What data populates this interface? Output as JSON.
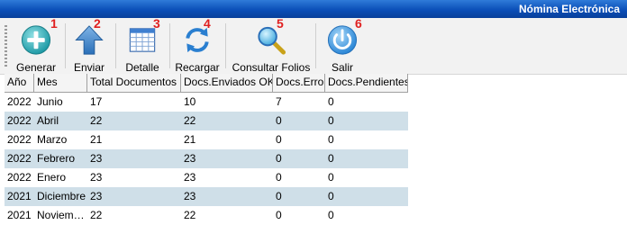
{
  "window": {
    "title": "Nómina Electrónica"
  },
  "toolbar": {
    "buttons": [
      {
        "label": "Generar",
        "badge": "1",
        "icon": "plus-circle-icon"
      },
      {
        "label": "Enviar",
        "badge": "2",
        "icon": "up-arrow-icon"
      },
      {
        "label": "Detalle",
        "badge": "3",
        "icon": "table-grid-icon"
      },
      {
        "label": "Recargar",
        "badge": "4",
        "icon": "refresh-icon"
      },
      {
        "label": "Consultar Folios",
        "badge": "5",
        "icon": "magnifier-icon"
      },
      {
        "label": "Salir",
        "badge": "6",
        "icon": "power-icon"
      }
    ]
  },
  "colors": {
    "badge": "#e02020",
    "alt_row": "#cfdfe8",
    "titlebar": "#0b4fb8"
  },
  "grid": {
    "columns": [
      "Año",
      "Mes",
      "Total Documentos",
      "Docs.Enviados OK",
      "Docs.Error",
      "Docs.Pendientes"
    ],
    "rows": [
      [
        "2022",
        "Junio",
        "17",
        "10",
        "7",
        "0"
      ],
      [
        "2022",
        "Abril",
        "22",
        "22",
        "0",
        "0"
      ],
      [
        "2022",
        "Marzo",
        "21",
        "21",
        "0",
        "0"
      ],
      [
        "2022",
        "Febrero",
        "23",
        "23",
        "0",
        "0"
      ],
      [
        "2022",
        "Enero",
        "23",
        "23",
        "0",
        "0"
      ],
      [
        "2021",
        "Diciembre",
        "23",
        "23",
        "0",
        "0"
      ],
      [
        "2021",
        "Noviem…",
        "22",
        "22",
        "0",
        "0"
      ]
    ]
  }
}
